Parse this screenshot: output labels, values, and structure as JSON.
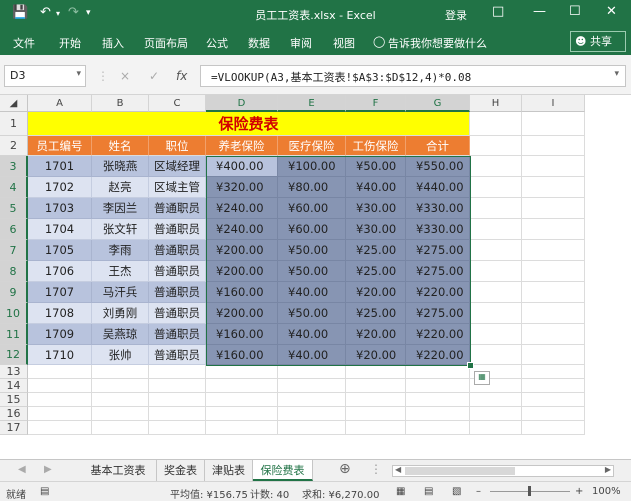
{
  "window": {
    "title": "员工工资表.xlsx  -  Excel",
    "login": "登录",
    "qat": [
      "save-icon",
      "undo-icon",
      "redo-icon",
      "customize-icon"
    ]
  },
  "ribbon": {
    "tabs": [
      "文件",
      "开始",
      "插入",
      "页面布局",
      "公式",
      "数据",
      "审阅",
      "视图"
    ],
    "tell_me": "告诉我你想要做什么",
    "share": "共享"
  },
  "formula_bar": {
    "name_box": "D3",
    "cancel": "×",
    "enter": "✓",
    "fx": "fx",
    "formula": "=VLOOKUP(A3,基本工资表!$A$3:$D$12,4)*0.08"
  },
  "columns": [
    "A",
    "B",
    "C",
    "D",
    "E",
    "F",
    "G",
    "H",
    "I"
  ],
  "rows": [
    "1",
    "2",
    "3",
    "4",
    "5",
    "6",
    "7",
    "8",
    "9",
    "10",
    "11",
    "12",
    "13",
    "14",
    "15",
    "16",
    "17"
  ],
  "sheet": {
    "title": "保险费表",
    "headers": [
      "员工编号",
      "姓名",
      "职位",
      "养老保险",
      "医疗保险",
      "工伤保险",
      "合计"
    ],
    "data": [
      [
        "1701",
        "张晓燕",
        "区域经理",
        "¥400.00",
        "¥100.00",
        "¥50.00",
        "¥550.00"
      ],
      [
        "1702",
        "赵亮",
        "区域主管",
        "¥320.00",
        "¥80.00",
        "¥40.00",
        "¥440.00"
      ],
      [
        "1703",
        "李因兰",
        "普通职员",
        "¥240.00",
        "¥60.00",
        "¥30.00",
        "¥330.00"
      ],
      [
        "1704",
        "张文轩",
        "普通职员",
        "¥240.00",
        "¥60.00",
        "¥30.00",
        "¥330.00"
      ],
      [
        "1705",
        "李雨",
        "普通职员",
        "¥200.00",
        "¥50.00",
        "¥25.00",
        "¥275.00"
      ],
      [
        "1706",
        "王杰",
        "普通职员",
        "¥200.00",
        "¥50.00",
        "¥25.00",
        "¥275.00"
      ],
      [
        "1707",
        "马汗兵",
        "普通职员",
        "¥160.00",
        "¥40.00",
        "¥20.00",
        "¥220.00"
      ],
      [
        "1708",
        "刘勇刚",
        "普通职员",
        "¥200.00",
        "¥50.00",
        "¥25.00",
        "¥275.00"
      ],
      [
        "1709",
        "吴燕琼",
        "普通职员",
        "¥160.00",
        "¥40.00",
        "¥20.00",
        "¥220.00"
      ],
      [
        "1710",
        "张帅",
        "普通职员",
        "¥160.00",
        "¥40.00",
        "¥20.00",
        "¥220.00"
      ]
    ]
  },
  "sheet_tabs": [
    "基本工资表",
    "奖金表",
    "津贴表",
    "保险费表"
  ],
  "active_sheet": "保险费表",
  "status": {
    "mode": "就绪",
    "average": "平均值: ¥156.75",
    "count": "计数: 40",
    "sum": "求和: ¥6,270.00",
    "zoom": "100%"
  }
}
